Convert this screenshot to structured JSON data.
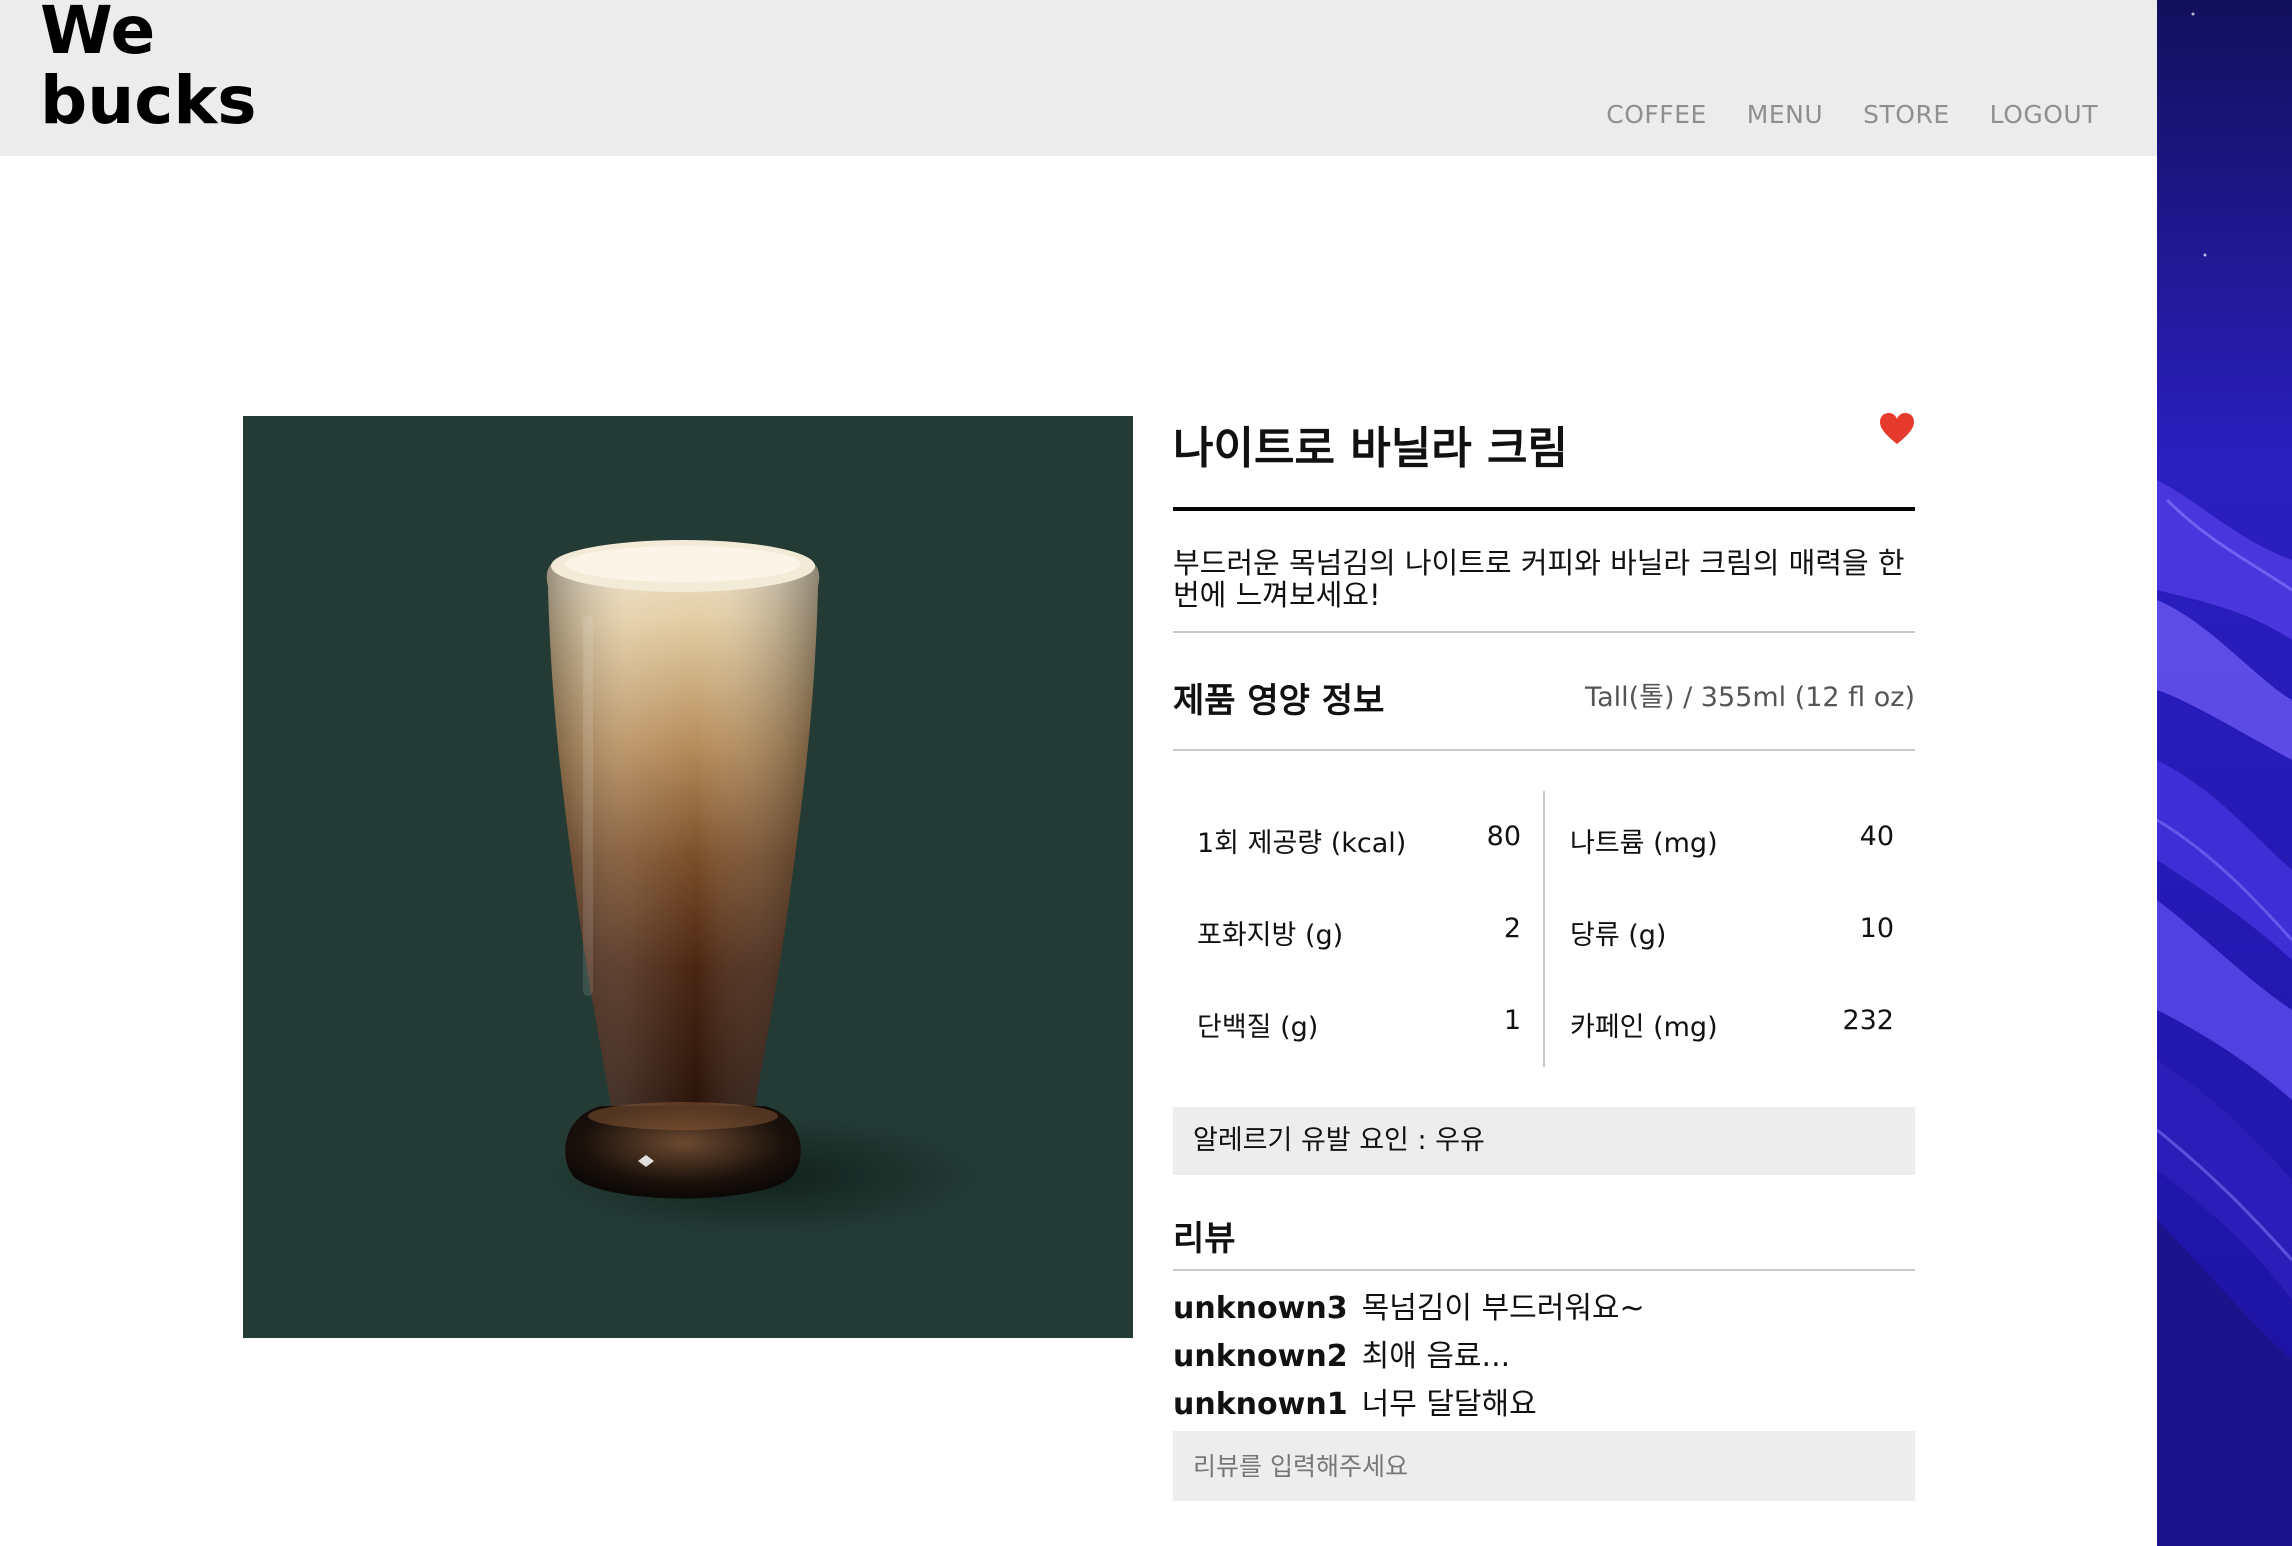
{
  "header": {
    "logo_line1": "We",
    "logo_line2": "bucks",
    "nav": [
      "COFFEE",
      "MENU",
      "STORE",
      "LOGOUT"
    ]
  },
  "product": {
    "name": "나이트로 바닐라 크림",
    "description": "부드러운 목넘김의 나이트로 커피와 바닐라 크림의 매력을 한번에 느껴보세요!",
    "liked": true,
    "image_bg_color": "#243b35"
  },
  "nutrition": {
    "title": "제품 영양 정보",
    "serving_size": "Tall(톨) / 355ml (12 fl oz)",
    "left": [
      {
        "label": "1회 제공량 (kcal)",
        "value": "80"
      },
      {
        "label": "포화지방 (g)",
        "value": "2"
      },
      {
        "label": "단백질 (g)",
        "value": "1"
      }
    ],
    "right": [
      {
        "label": "나트륨 (mg)",
        "value": "40"
      },
      {
        "label": "당류 (g)",
        "value": "10"
      },
      {
        "label": "카페인 (mg)",
        "value": "232"
      }
    ]
  },
  "allergy": "알레르기 유발 요인 : 우유",
  "reviews": {
    "title": "리뷰",
    "items": [
      {
        "user": "unknown3",
        "text": "목넘김이 부드러워요~"
      },
      {
        "user": "unknown2",
        "text": "최애 음료..."
      },
      {
        "user": "unknown1",
        "text": "너무 달달해요"
      }
    ],
    "input_placeholder": "리뷰를 입력해주세요"
  },
  "colors": {
    "header_bg": "#ececec",
    "heart": "#e53a2c",
    "decor_bg": "#2a23c8"
  }
}
